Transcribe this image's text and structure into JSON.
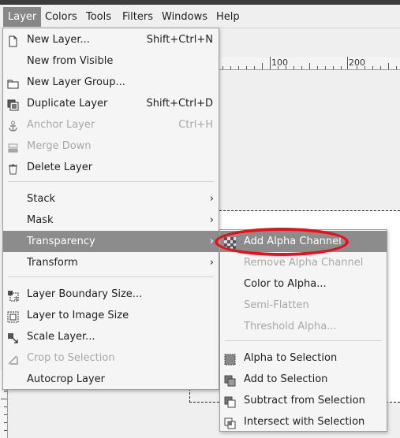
{
  "menubar": {
    "items": [
      {
        "label": "Layer"
      },
      {
        "label": "Colors"
      },
      {
        "label": "Tools"
      },
      {
        "label": "Filters"
      },
      {
        "label": "Windows"
      },
      {
        "label": "Help"
      }
    ]
  },
  "ruler": {
    "labels": [
      "100",
      "200"
    ]
  },
  "layer_menu": {
    "items": [
      {
        "label": "New Layer...",
        "accel": "Shift+Ctrl+N",
        "icon": "new-layer-icon"
      },
      {
        "label": "New from Visible",
        "accel": "",
        "icon": ""
      },
      {
        "label": "New Layer Group...",
        "accel": "",
        "icon": "folder-icon"
      },
      {
        "label": "Duplicate Layer",
        "accel": "Shift+Ctrl+D",
        "icon": "duplicate-icon"
      },
      {
        "label": "Anchor Layer",
        "accel": "Ctrl+H",
        "icon": "anchor-icon"
      },
      {
        "label": "Merge Down",
        "accel": "",
        "icon": "merge-down-icon"
      },
      {
        "label": "Delete Layer",
        "accel": "",
        "icon": "trash-icon"
      },
      {
        "label": "Stack",
        "submenu": true
      },
      {
        "label": "Mask",
        "submenu": true
      },
      {
        "label": "Transparency",
        "submenu": true
      },
      {
        "label": "Transform",
        "submenu": true
      },
      {
        "label": "Layer Boundary Size...",
        "icon": "boundary-size-icon"
      },
      {
        "label": "Layer to Image Size",
        "icon": "layer-to-image-icon"
      },
      {
        "label": "Scale Layer...",
        "icon": "scale-icon"
      },
      {
        "label": "Crop to Selection",
        "icon": "crop-icon"
      },
      {
        "label": "Autocrop Layer",
        "icon": ""
      }
    ]
  },
  "transparency_menu": {
    "items": [
      {
        "label": "Add Alpha Channel",
        "icon": "checker-icon"
      },
      {
        "label": "Remove Alpha Channel"
      },
      {
        "label": "Color to Alpha..."
      },
      {
        "label": "Semi-Flatten"
      },
      {
        "label": "Threshold Alpha..."
      },
      {
        "label": "Alpha to Selection",
        "icon": "alpha-selection-icon"
      },
      {
        "label": "Add to Selection",
        "icon": "add-selection-icon"
      },
      {
        "label": "Subtract from Selection",
        "icon": "subtract-selection-icon"
      },
      {
        "label": "Intersect with Selection",
        "icon": "intersect-selection-icon"
      }
    ]
  },
  "colors": {
    "highlight": "#8c8c8c",
    "annotation": "#e8101a",
    "disabled": "#a8a8a8"
  }
}
